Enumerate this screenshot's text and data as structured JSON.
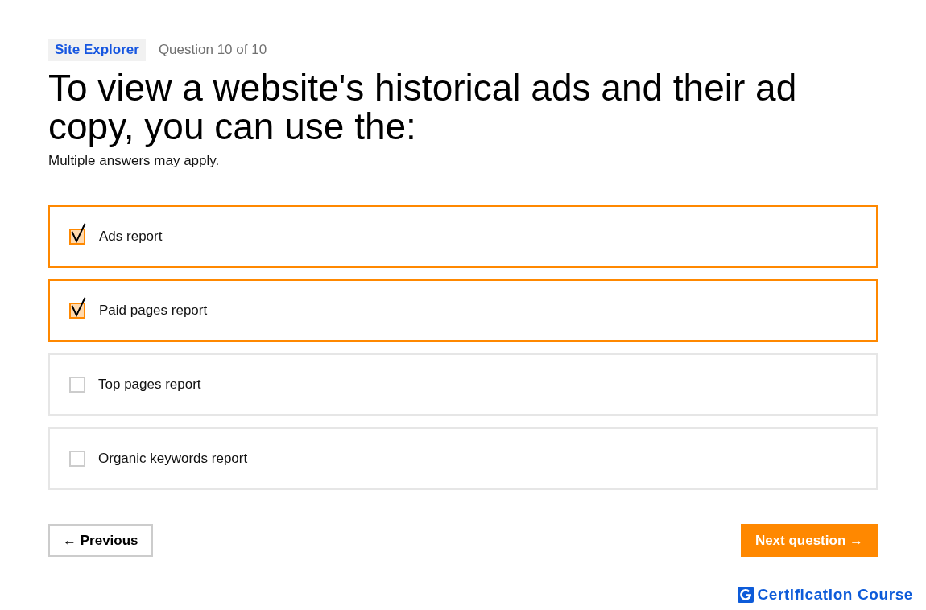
{
  "header": {
    "tag": "Site Explorer",
    "counter": "Question 10 of 10"
  },
  "question": "To view a website's historical ads and their ad copy, you can use the:",
  "hint": "Multiple answers may apply.",
  "options": [
    {
      "label": "Ads report",
      "checked": true
    },
    {
      "label": "Paid pages report",
      "checked": true
    },
    {
      "label": "Top pages report",
      "checked": false
    },
    {
      "label": "Organic keywords report",
      "checked": false
    }
  ],
  "buttons": [
    {
      "label": "← Previous",
      "kind": "secondary"
    },
    {
      "label": "Next question →",
      "kind": "primary"
    }
  ],
  "footer": {
    "brand": "Certification Course"
  }
}
